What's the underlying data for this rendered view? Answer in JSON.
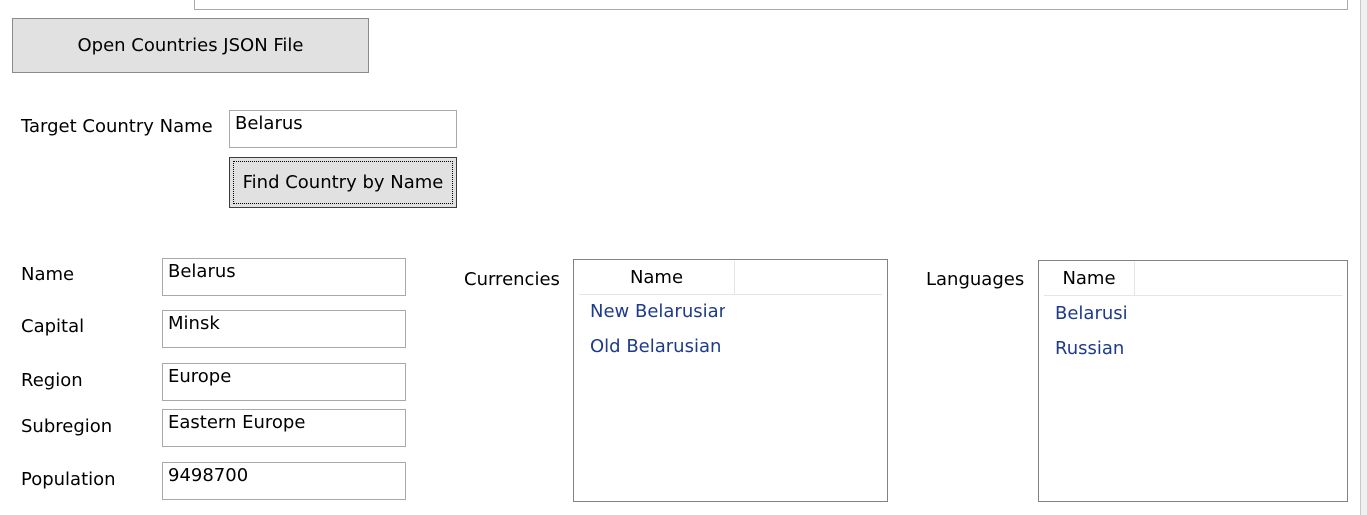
{
  "toolbar": {
    "open_label": "Open Countries JSON File"
  },
  "search": {
    "target_label": "Target Country Name",
    "target_value": "Belarus",
    "find_label": "Find Country by Name"
  },
  "details": {
    "name_label": "Name",
    "name_value": "Belarus",
    "capital_label": "Capital",
    "capital_value": "Minsk",
    "region_label": "Region",
    "region_value": "Europe",
    "subregion_label": "Subregion",
    "subregion_value": "Eastern Europe",
    "population_label": "Population",
    "population_value": "9498700"
  },
  "currencies": {
    "label": "Currencies",
    "column": "Name",
    "items": [
      "New Belarusian",
      "Old Belarusian"
    ]
  },
  "languages": {
    "label": "Languages",
    "column": "Name",
    "items": [
      "Belarusi",
      "Russian"
    ]
  }
}
